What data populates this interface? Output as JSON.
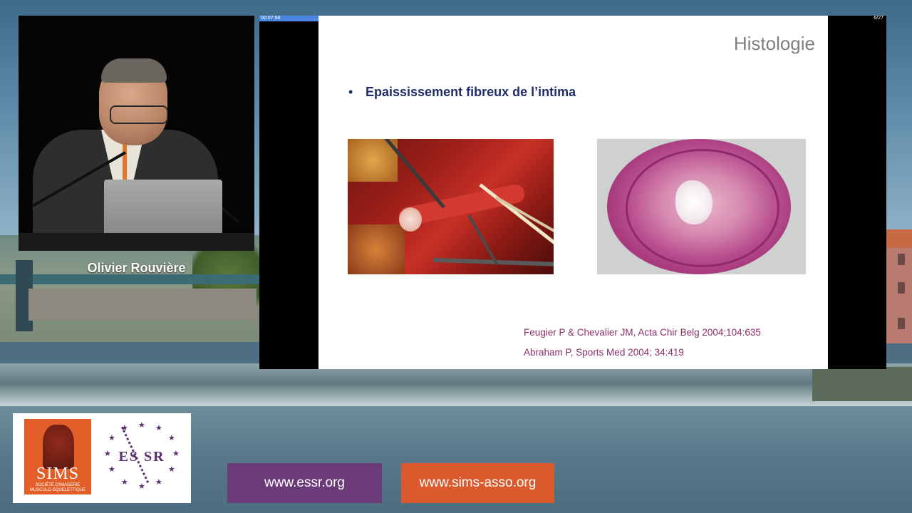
{
  "speaker": {
    "name": "Olivier Rouvière"
  },
  "player": {
    "elapsed": "00:07:58",
    "slide_counter": "6/27",
    "progress_fraction": 0.2,
    "accent_color": "#4a86e0"
  },
  "slide": {
    "title": "Histologie",
    "bullet_marker": "•",
    "bullet": "Epaississement fibreux de l’intima",
    "images": [
      "surgery-photo",
      "histology-photo"
    ],
    "references": [
      "Feugier P & Chevalier JM, Acta Chir Belg 2004;104:635",
      "Abraham P, Sports Med 2004; 34:419"
    ]
  },
  "logos": {
    "sims": {
      "name": "SIMS",
      "subtitle_1": "SOCIÉTÉ D'IMAGERIE",
      "subtitle_2": "MUSCULO-SQUELETTIQUE"
    },
    "essr": {
      "name": "ES SR"
    }
  },
  "links": {
    "essr": "www.essr.org",
    "sims": "www.sims-asso.org"
  },
  "colors": {
    "essr_purple": "#6b3a78",
    "sims_orange": "#db5a2d",
    "bullet_navy": "#1f2d6b",
    "reference_magenta": "#8c2e6a"
  }
}
